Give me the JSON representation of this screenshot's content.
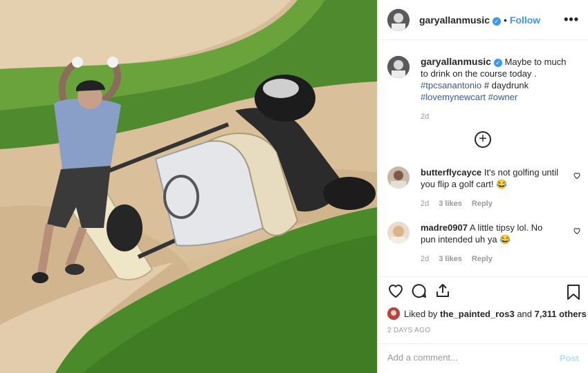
{
  "post": {
    "author": "garyallanmusic",
    "follow_label": "Follow",
    "caption": {
      "text": "Maybe to much to drink on the course today .",
      "hashtags": [
        "#tpcsanantonio",
        "#",
        "daydrunk",
        "#lovemynewcart",
        "#owner"
      ],
      "age": "2d"
    },
    "load_more_icon": "plus-circle-icon"
  },
  "comments": [
    {
      "user": "butterflycayce",
      "text": "It's not golfing until you flip a golf cart!",
      "emoji": "😂",
      "age": "2d",
      "likes": "3 likes",
      "reply_label": "Reply"
    },
    {
      "user": "madre0907",
      "text": "A little tipsy lol. No pun intended uh ya",
      "emoji": "😂",
      "age": "2d",
      "likes": "3 likes",
      "reply_label": "Reply"
    }
  ],
  "likes": {
    "prefix": "Liked by",
    "user": "the_painted_ros3",
    "conjunction": "and",
    "others": "7,311 others"
  },
  "date": "2 DAYS AGO",
  "add_comment": {
    "placeholder": "Add a comment...",
    "post_label": "Post"
  },
  "icons": {
    "like": "heart-icon",
    "comment": "comment-icon",
    "share": "share-icon",
    "save": "bookmark-icon",
    "more": "more-options-icon",
    "verified": "verified-badge-icon"
  },
  "colors": {
    "link": "#3897f0",
    "hashtag": "#3a5a8c",
    "muted": "#999999",
    "post_disabled": "#b2dffc"
  }
}
